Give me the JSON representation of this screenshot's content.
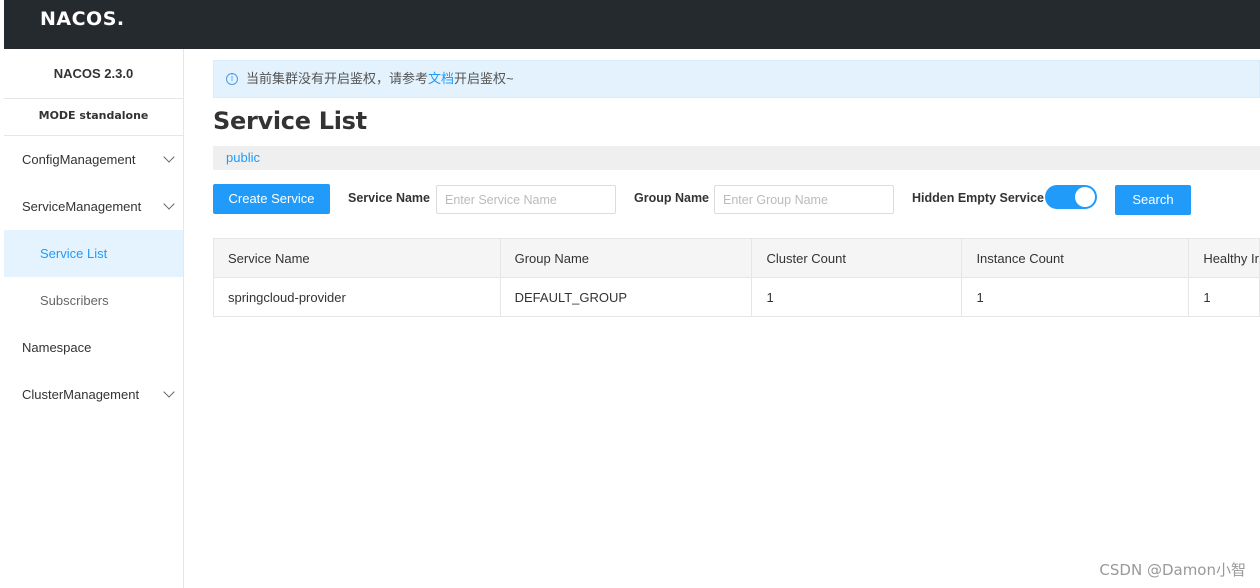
{
  "header": {
    "logo": "NACOS."
  },
  "sidebar": {
    "version": "NACOS 2.3.0",
    "mode": "MODE standalone",
    "items": [
      {
        "label": "ConfigManagement"
      },
      {
        "label": "ServiceManagement"
      },
      {
        "label": "Service List"
      },
      {
        "label": "Subscribers"
      },
      {
        "label": "Namespace"
      },
      {
        "label": "ClusterManagement"
      }
    ]
  },
  "notice": {
    "before": "当前集群没有开启鉴权，请参考",
    "link": "文档",
    "after": "开启鉴权~",
    "icon": "info-icon"
  },
  "main": {
    "title": "Service List",
    "namespace": "public",
    "toolbar": {
      "create_label": "Create Service",
      "service_name_label": "Service Name",
      "service_name_placeholder": "Enter Service Name",
      "group_name_label": "Group Name",
      "group_name_placeholder": "Enter Group Name",
      "hidden_empty_label": "Hidden Empty Service",
      "hidden_empty_on": true,
      "search_label": "Search"
    },
    "table": {
      "headers": [
        "Service Name",
        "Group Name",
        "Cluster Count",
        "Instance Count",
        "Healthy Ir"
      ],
      "rows": [
        [
          "springcloud-provider",
          "DEFAULT_GROUP",
          "1",
          "1",
          "1"
        ]
      ]
    }
  },
  "watermark": "CSDN @Damon小智",
  "colors": {
    "accent": "#209bfa",
    "header_bg": "#252a2f",
    "active_bg": "#e4f3fe",
    "notice_bg": "#e3f2fd"
  }
}
